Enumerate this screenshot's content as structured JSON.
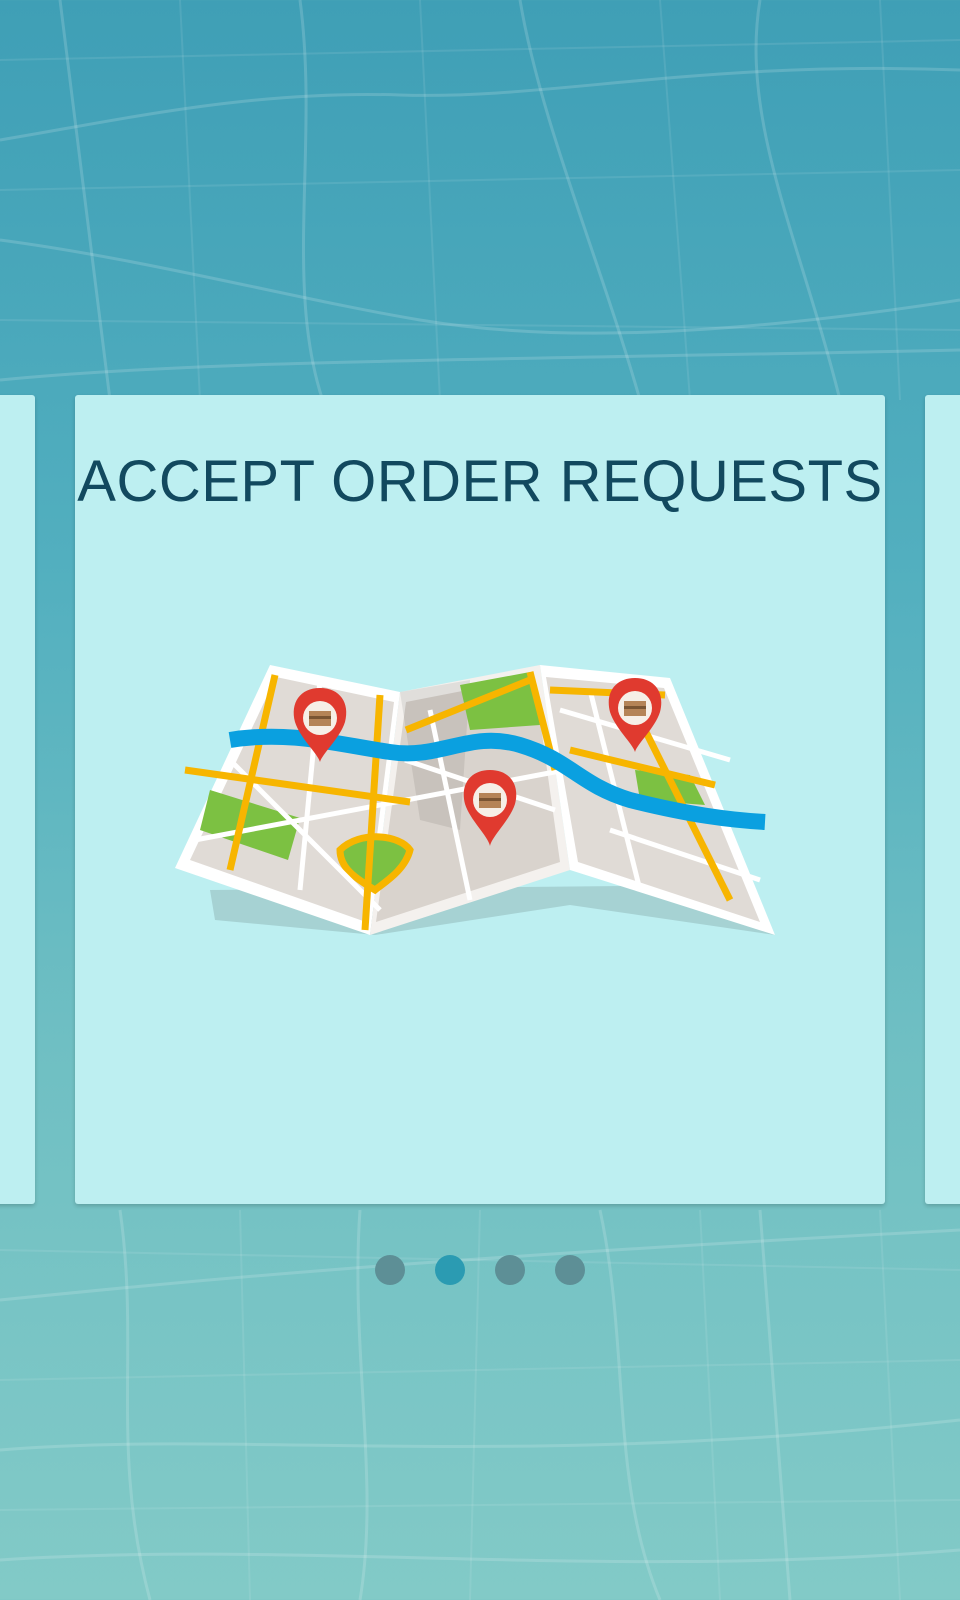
{
  "onboarding": {
    "title": "ACCEPT ORDER REQUESTS",
    "illustration_icon": "city-map-with-location-pins-illustration",
    "pages": [
      {
        "active": false
      },
      {
        "active": true
      },
      {
        "active": false
      },
      {
        "active": false
      }
    ],
    "current_page": 2,
    "page_count": 4
  },
  "colors": {
    "card_background": "#bdeff1",
    "title_text": "#12495f",
    "dot_active": "#2b9bb2",
    "dot_inactive": "#5d8f96",
    "pin_red": "#e03a2f",
    "road_yellow": "#f7b500",
    "river_blue": "#0aa0e0",
    "park_green": "#7cc142"
  }
}
